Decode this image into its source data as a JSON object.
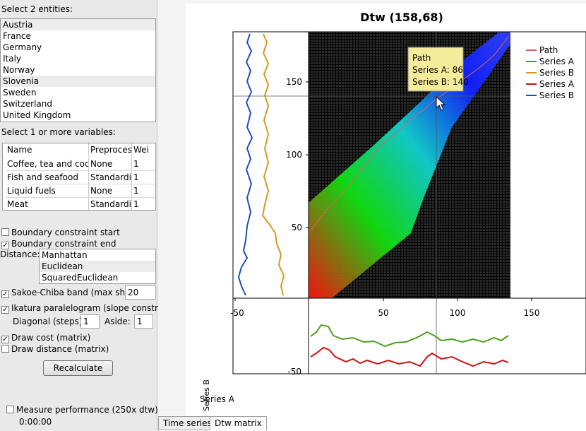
{
  "left": {
    "entities_label": "Select 2 entities:",
    "entities": [
      "Austria",
      "France",
      "Germany",
      "Italy",
      "Norway",
      "Slovenia",
      "Sweden",
      "Switzerland",
      "United Kingdom"
    ],
    "variables_label": "Select 1 or more variables:",
    "grid_headers": [
      "Name",
      "Preproces",
      "Wei"
    ],
    "grid_rows": [
      [
        "Coffee, tea and cocoa",
        "None",
        "1"
      ],
      [
        "Fish and seafood",
        "Standardiz",
        "1"
      ],
      [
        "Liquid fuels",
        "None",
        "1"
      ],
      [
        "Meat",
        "Standardiz",
        "1"
      ]
    ],
    "boundary_start": {
      "label": "Boundary constraint start",
      "checked": false
    },
    "boundary_end": {
      "label": "Boundary constraint end",
      "checked": true
    },
    "distance_label": "Distance:",
    "distances": [
      "Manhattan",
      "Euclidean",
      "SquaredEuclidean"
    ],
    "sakoe": {
      "label": "Sakoe-Chiba band (max shift):",
      "checked": true,
      "value": "20"
    },
    "ikatura": {
      "label": "Ikatura paralelogram (slope constr.):",
      "checked": true
    },
    "diagonal_label": "Diagonal (steps):",
    "diagonal_value": "1",
    "aside_label": "Aside:",
    "aside_value": "1",
    "draw_cost": {
      "label": "Draw cost (matrix)",
      "checked": true
    },
    "draw_distance": {
      "label": "Draw distance (matrix)",
      "checked": false
    },
    "recalculate": "Recalculate",
    "measure": {
      "label": "Measure performance (250x dtw)",
      "checked": false
    },
    "timer": "0:00:00"
  },
  "plot": {
    "title": "Dtw (158,68)",
    "y_ticks": [
      "150",
      "100",
      "50"
    ],
    "x_ticks_bottom": [
      "-50",
      "50",
      "100",
      "150"
    ],
    "lower_tick": "-50",
    "legend": [
      {
        "name": "Path",
        "color": "#e06060"
      },
      {
        "name": "Series A",
        "color": "#4aa020"
      },
      {
        "name": "Series B",
        "color": "#d49a20"
      },
      {
        "name": "Series A",
        "color": "#d01010"
      },
      {
        "name": "Series B",
        "color": "#2050b0"
      }
    ],
    "tooltip": {
      "title": "Path",
      "line1": "Series A: 86",
      "line2": "Series B: 140"
    },
    "axis_b": "Series B",
    "axis_a": "Series A"
  },
  "tabs": [
    "Time series",
    "Dtw matrix"
  ]
}
